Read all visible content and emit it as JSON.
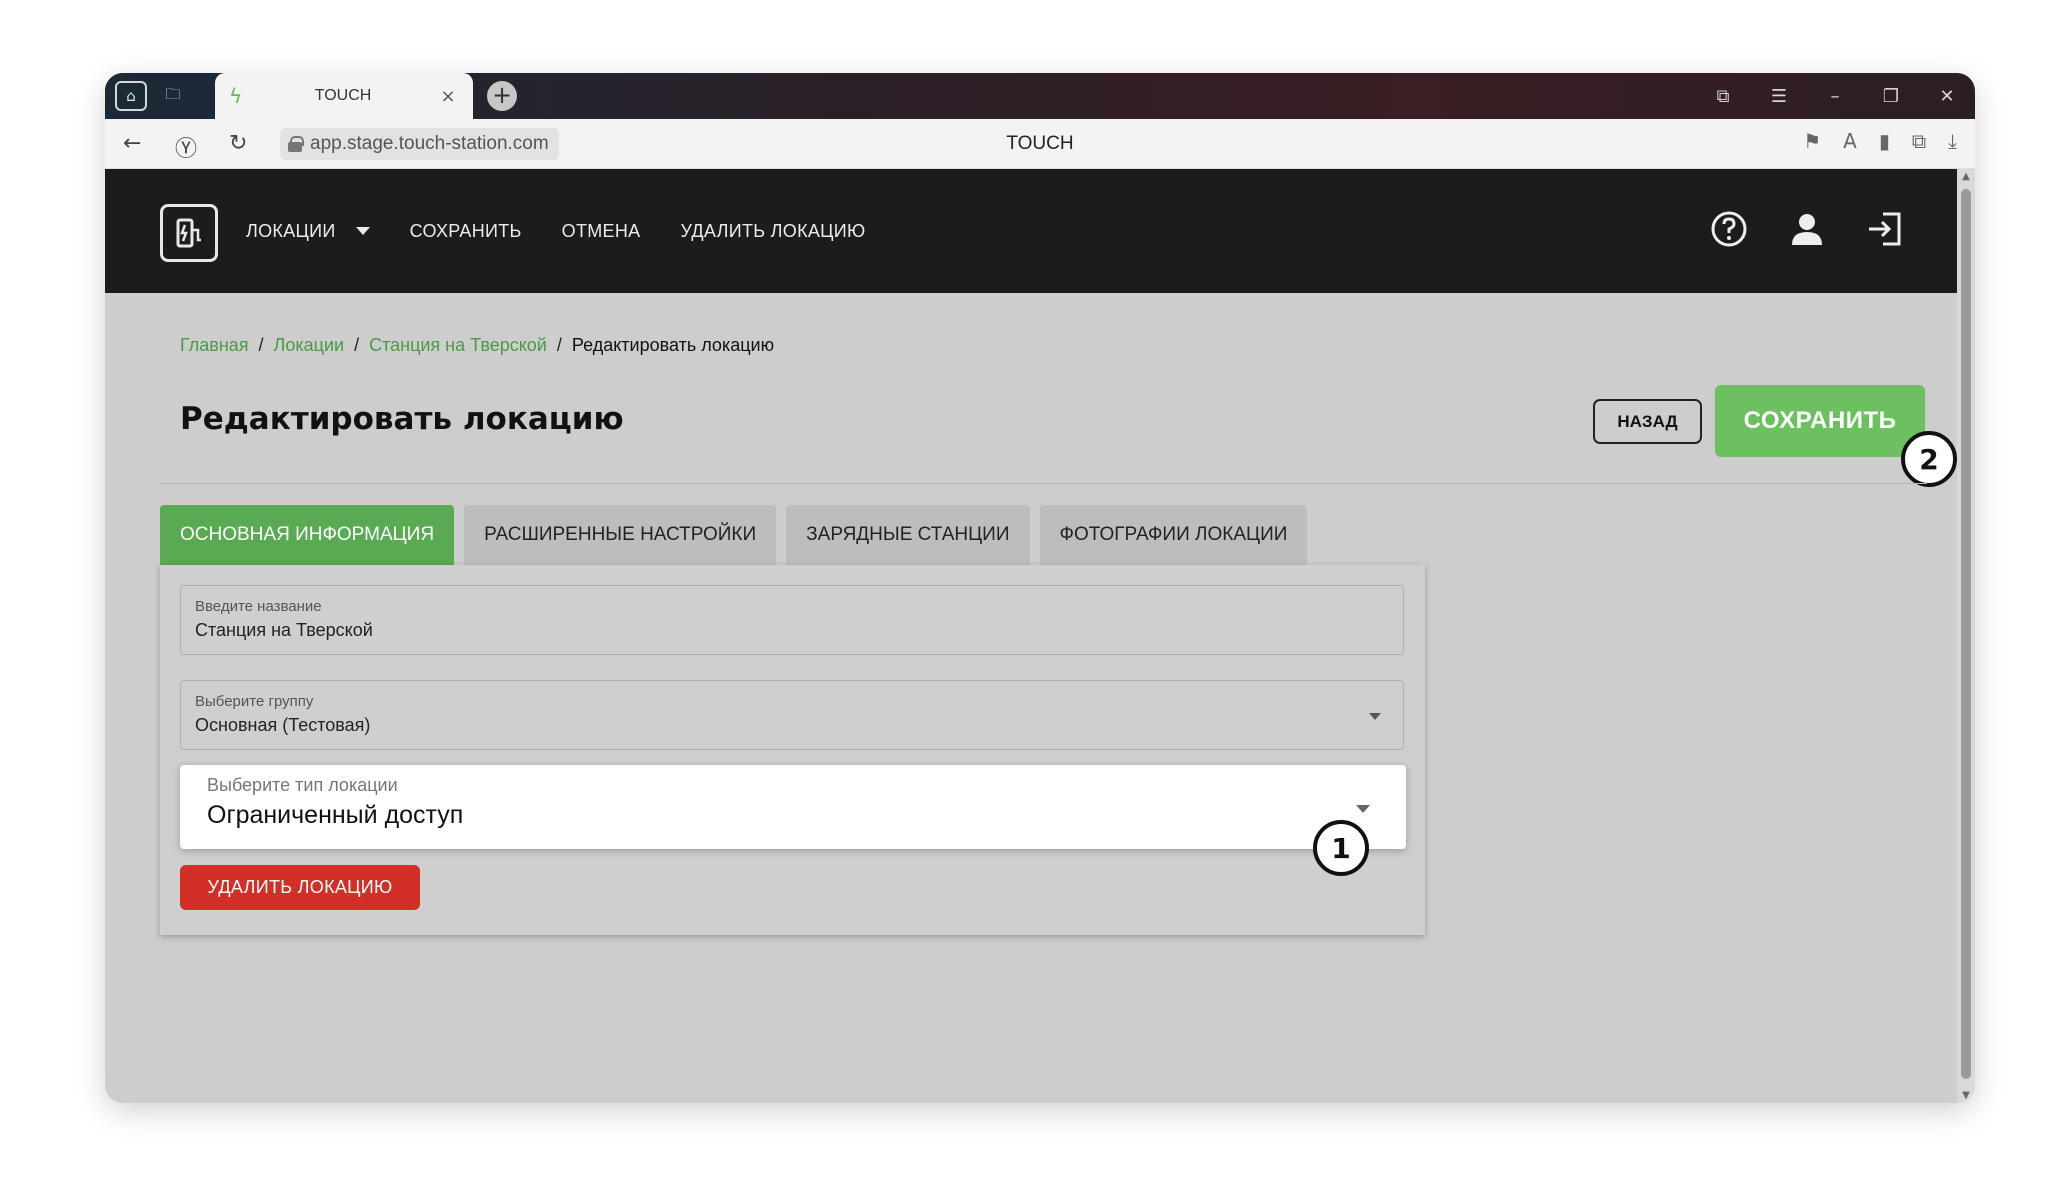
{
  "browser": {
    "tab_title": "TOUCH",
    "tab_close": "×",
    "new_tab": "+",
    "url": "app.stage.touch-station.com",
    "page_title": "TOUCH",
    "window_controls": [
      "⧉",
      "☰",
      "–",
      "❐",
      "✕"
    ]
  },
  "app_header": {
    "menu": {
      "locations": "ЛОКАЦИИ",
      "save": "СОХРАНИТЬ",
      "cancel": "ОТМЕНА",
      "delete_location": "УДАЛИТЬ ЛОКАЦИЮ"
    },
    "icons": [
      "help-icon",
      "user-icon",
      "logout-icon"
    ]
  },
  "breadcrumb": {
    "home": "Главная",
    "locations": "Локации",
    "station": "Станция на Тверской",
    "current": "Редактировать локацию",
    "separator": "/"
  },
  "page": {
    "title": "Редактировать локацию",
    "back_button": "НАЗАД",
    "save_button": "СОХРАНИТЬ"
  },
  "tabs": [
    {
      "label": "ОСНОВНАЯ ИНФОРМАЦИЯ",
      "active": true
    },
    {
      "label": "РАСШИРЕННЫЕ НАСТРОЙКИ",
      "active": false
    },
    {
      "label": "ЗАРЯДНЫЕ СТАНЦИИ",
      "active": false
    },
    {
      "label": "ФОТОГРАФИИ ЛОКАЦИИ",
      "active": false
    }
  ],
  "form": {
    "name": {
      "label": "Введите название",
      "value": "Станция на Тверской"
    },
    "group": {
      "label": "Выберите группу",
      "value": "Основная (Тестовая)"
    },
    "type": {
      "label": "Выберите тип локации",
      "value": "Ограниченный доступ"
    },
    "delete_button": "УДАЛИТЬ ЛОКАЦИЮ"
  },
  "annotations": {
    "badge_1": "1",
    "badge_2": "2"
  },
  "colors": {
    "accent_green": "#5aa953",
    "save_green": "#6cc05f",
    "delete_red": "#d22f27",
    "header_dark": "#1c1c1c"
  }
}
